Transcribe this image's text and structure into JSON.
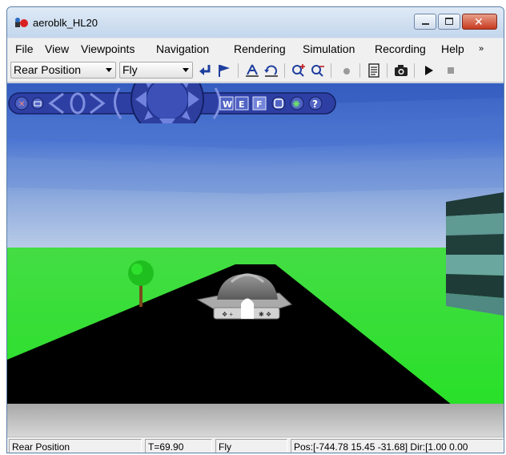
{
  "window": {
    "title": "aeroblk_HL20"
  },
  "menu": [
    {
      "id": "file",
      "label": "File"
    },
    {
      "id": "view",
      "label": "View"
    },
    {
      "id": "viewpoints",
      "label": "Viewpoints"
    },
    {
      "id": "navigation",
      "label": "Navigation"
    },
    {
      "id": "rendering",
      "label": "Rendering"
    },
    {
      "id": "simulation",
      "label": "Simulation"
    },
    {
      "id": "recording",
      "label": "Recording"
    },
    {
      "id": "help",
      "label": "Help"
    }
  ],
  "toolbar": {
    "viewpoint_value": "Rear Position",
    "navmode_value": "Fly",
    "icons": [
      "return-arrow-icon",
      "flag-icon",
      "straighten-icon",
      "undo-move-icon",
      "zoom-in-icon",
      "zoom-out-icon",
      "record-icon",
      "edit-icon",
      "snapshot-icon",
      "play-icon",
      "stop-icon"
    ]
  },
  "navpanel": {
    "buttons": [
      "W",
      "E",
      "F",
      "?"
    ]
  },
  "status": {
    "viewpoint": "Rear Position",
    "time": "T=69.90",
    "mode": "Fly",
    "position": "Pos:[-744.78 15.45 -31.68] Dir:[1.00 0.00"
  },
  "colors": {
    "sky_top": "#3a64c8",
    "sky_bottom": "#b4c8e6",
    "ground": "#33e633",
    "runway": "#000000",
    "nav_panel": "#2b3d9c"
  }
}
